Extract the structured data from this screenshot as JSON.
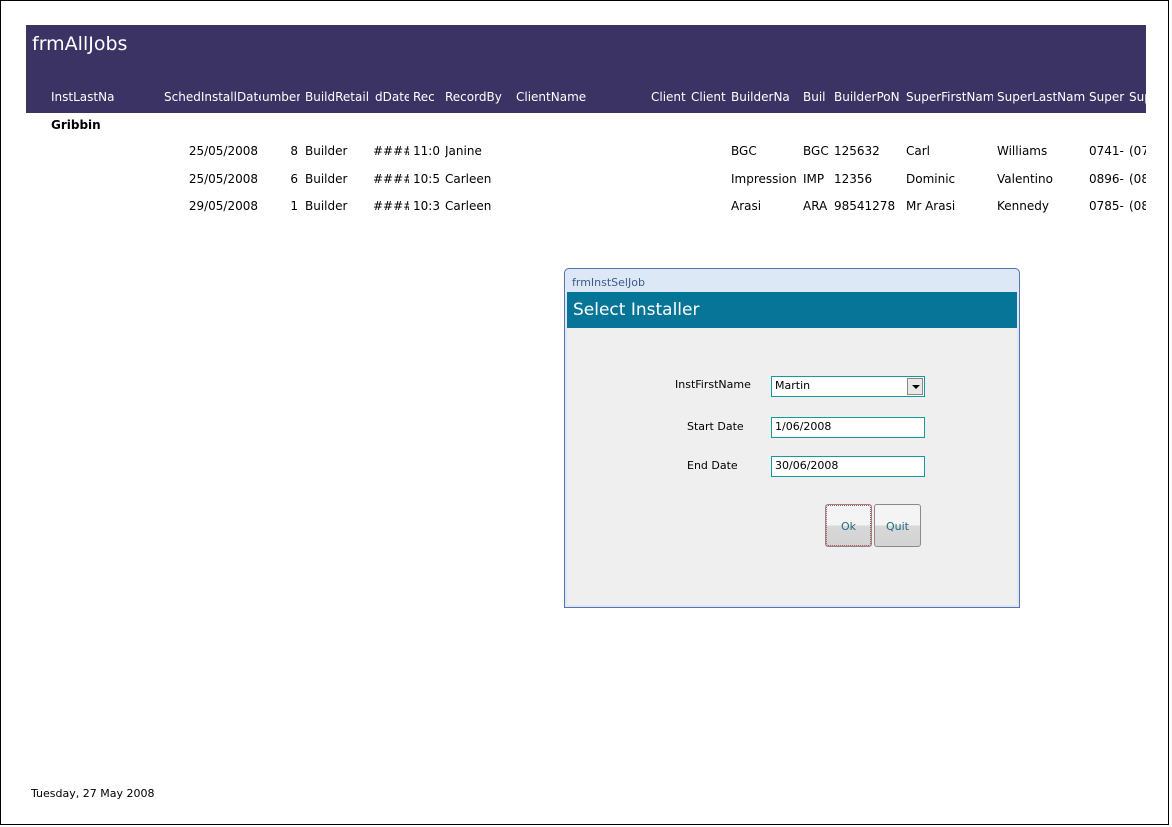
{
  "form_title": "frmAllJobs",
  "headers": [
    "InstLastNa",
    "SchedInstallDate",
    "umber",
    "BuildRetail",
    "dDate",
    "Rec",
    "RecordBy",
    "ClientName",
    "Client",
    "Client",
    "BuilderNa",
    "Buil",
    "BuilderPoN",
    "SuperFirstNam",
    "SuperLastNam",
    "Super",
    "Sup"
  ],
  "group": "Gribbin",
  "rows": [
    [
      "25/05/2008",
      "8",
      "Builder",
      "#####",
      "11:0",
      "Janine",
      "BGC",
      "BGC",
      "125632",
      "Carl",
      "Williams",
      "0741-",
      "(07"
    ],
    [
      "25/05/2008",
      "6",
      "Builder",
      "#####",
      "10:5",
      "Carleen",
      "Impression",
      "IMP",
      "12356",
      "Dominic",
      "Valentino",
      "0896-",
      "(08"
    ],
    [
      "29/05/2008",
      "1",
      "Builder",
      "#####",
      "10:3",
      "Carleen",
      "Arasi",
      "ARA",
      "98541278",
      "Mr Arasi",
      "Kennedy",
      "0785-",
      "(08"
    ]
  ],
  "footer_date": "Tuesday, 27 May 2008",
  "dialog": {
    "caption": "frmInstSelJob",
    "heading": "Select Installer",
    "inst_label": "InstFirstName",
    "inst_value": "Martin",
    "start_label": "Start Date",
    "start_value": "1/06/2008",
    "end_label": "End Date",
    "end_value": "30/06/2008",
    "ok": "Ok",
    "quit": "Quit"
  }
}
